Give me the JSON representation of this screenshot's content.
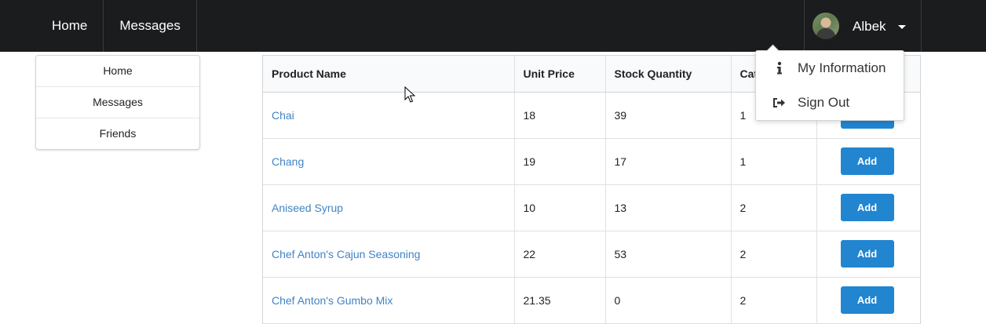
{
  "topnav": {
    "items": [
      "Home",
      "Messages"
    ],
    "user": {
      "name": "Albek"
    }
  },
  "sidebar": {
    "items": [
      "Home",
      "Messages",
      "Friends"
    ]
  },
  "table": {
    "headers": [
      "Product Name",
      "Unit Price",
      "Stock Quantity",
      "Cat",
      ""
    ],
    "rows": [
      {
        "name": "Chai",
        "price": "18",
        "stock": "39",
        "category": "1",
        "action": "Add"
      },
      {
        "name": "Chang",
        "price": "19",
        "stock": "17",
        "category": "1",
        "action": "Add"
      },
      {
        "name": "Aniseed Syrup",
        "price": "10",
        "stock": "13",
        "category": "2",
        "action": "Add"
      },
      {
        "name": "Chef Anton's Cajun Seasoning",
        "price": "22",
        "stock": "53",
        "category": "2",
        "action": "Add"
      },
      {
        "name": "Chef Anton's Gumbo Mix",
        "price": "21.35",
        "stock": "0",
        "category": "2",
        "action": "Add"
      }
    ]
  },
  "user_dropdown": {
    "items": [
      {
        "label": "My Information",
        "icon": "info-icon"
      },
      {
        "label": "Sign Out",
        "icon": "sign-out-icon"
      }
    ]
  },
  "colors": {
    "topbar": "#1b1c1d",
    "link": "#4183c4",
    "primary_button": "#2185d0"
  }
}
